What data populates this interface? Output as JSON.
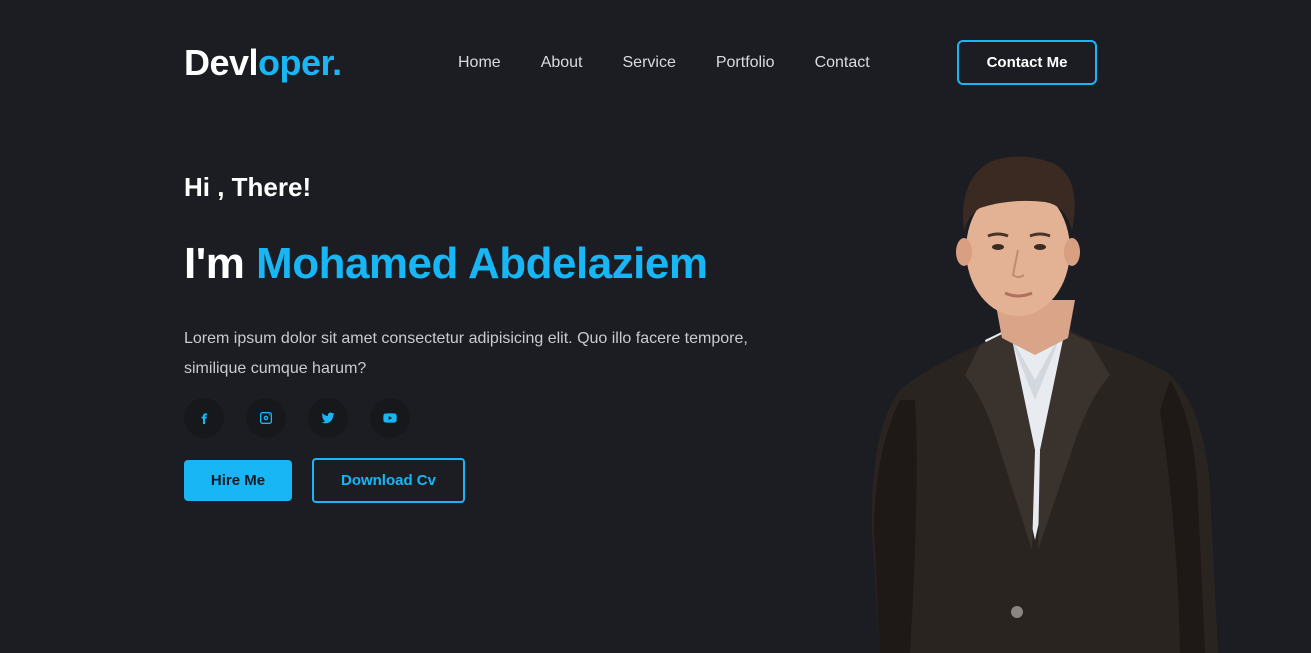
{
  "header": {
    "logo_main": "Devl",
    "logo_accent": "oper.",
    "nav": [
      "Home",
      "About",
      "Service",
      "Portfolio",
      "Contact"
    ],
    "contact_button": "Contact Me"
  },
  "hero": {
    "greeting": "Hi , There!",
    "headline_prefix": "I'm ",
    "headline_name": "Mohamed Abdelaziem",
    "description": "Lorem ipsum dolor sit amet consectetur adipisicing elit. Quo illo facere tempore, similique cumque harum?",
    "socials": [
      "facebook-icon",
      "instagram-icon",
      "twitter-icon",
      "youtube-icon"
    ],
    "hire_button": "Hire Me",
    "download_button": "Download Cv"
  },
  "colors": {
    "background": "#1b1d22",
    "accent": "#18b6f5",
    "text": "#ffffff",
    "muted_text": "#c8cbd1"
  }
}
